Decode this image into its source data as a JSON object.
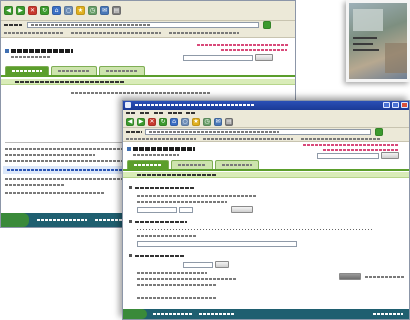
{
  "colors": {
    "title_bar": "#2a4fb6",
    "toolbar_bg": "#ece9d8",
    "tab_active": "#5b9e2c",
    "tab_inactive": "#cde4ad",
    "stripe": "#d9ecb8",
    "accent_link": "#d94a7a",
    "taskbar": "#1f5f70",
    "highlight": "#dce8fa"
  },
  "back_window": {
    "toolbar_icons": [
      {
        "name": "back-icon",
        "color": "#3c9a2e"
      },
      {
        "name": "forward-icon",
        "color": "#3c9a2e"
      },
      {
        "name": "stop-icon",
        "color": "#c8392e"
      },
      {
        "name": "refresh-icon",
        "color": "#3c9a2e"
      },
      {
        "name": "home-icon",
        "color": "#3b6fc4"
      },
      {
        "name": "search-icon",
        "color": "#6f8fb8"
      },
      {
        "name": "favorites-icon",
        "color": "#e0b020"
      },
      {
        "name": "history-icon",
        "color": "#6aa06a"
      },
      {
        "name": "mail-icon",
        "color": "#4a78b8"
      },
      {
        "name": "print-icon",
        "color": "#808080"
      }
    ]
  },
  "front_window": {
    "toolbar_icons": [
      {
        "name": "back-icon",
        "color": "#3c9a2e"
      },
      {
        "name": "forward-icon",
        "color": "#3c9a2e"
      },
      {
        "name": "stop-icon",
        "color": "#c8392e"
      },
      {
        "name": "refresh-icon",
        "color": "#3c9a2e"
      },
      {
        "name": "home-icon",
        "color": "#3b6fc4"
      },
      {
        "name": "search-icon",
        "color": "#6f8fb8"
      },
      {
        "name": "favorites-icon",
        "color": "#e0b020"
      },
      {
        "name": "history-icon",
        "color": "#6aa06a"
      },
      {
        "name": "mail-icon",
        "color": "#4a78b8"
      },
      {
        "name": "print-icon",
        "color": "#808080"
      }
    ]
  }
}
